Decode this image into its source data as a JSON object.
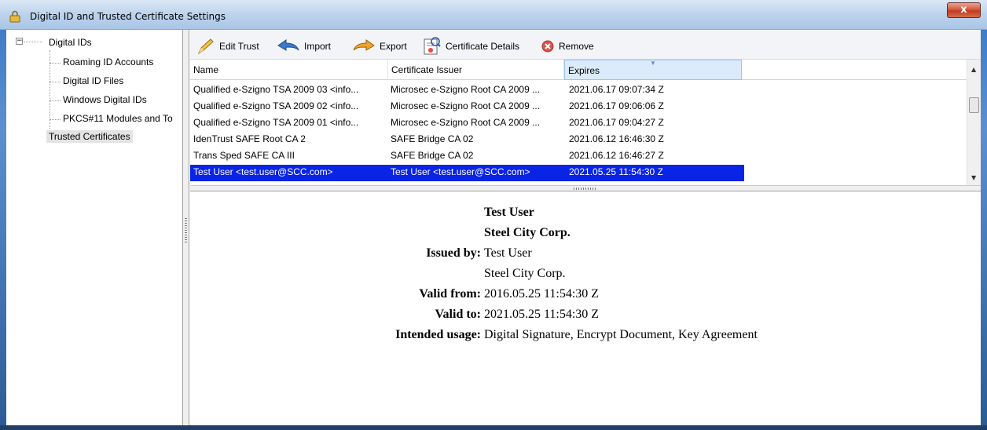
{
  "window": {
    "title": "Digital ID and Trusted Certificate Settings",
    "close_label": "x"
  },
  "tree": {
    "root": "Digital IDs",
    "children": [
      "Roaming ID Accounts",
      "Digital ID Files",
      "Windows Digital IDs",
      "PKCS#11 Modules and To"
    ],
    "trusted": "Trusted Certificates"
  },
  "toolbar": {
    "edit_trust": "Edit Trust",
    "import": "Import",
    "export": "Export",
    "certificate_details": "Certificate Details",
    "remove": "Remove"
  },
  "table": {
    "columns": [
      "Name",
      "Certificate Issuer",
      "Expires"
    ],
    "rows": [
      {
        "name": "Qualified e-Szigno TSA 2009 03 <info...",
        "issuer": "Microsec e-Szigno Root CA 2009 ...",
        "expires": "2021.06.17 09:07:34 Z"
      },
      {
        "name": "Qualified e-Szigno TSA 2009 02 <info...",
        "issuer": "Microsec e-Szigno Root CA 2009 ...",
        "expires": "2021.06.17 09:06:06 Z"
      },
      {
        "name": "Qualified e-Szigno TSA 2009 01 <info...",
        "issuer": "Microsec e-Szigno Root CA 2009 ...",
        "expires": "2021.06.17 09:04:27 Z"
      },
      {
        "name": "IdenTrust SAFE Root CA 2",
        "issuer": "SAFE Bridge CA 02",
        "expires": "2021.06.12 16:46:30 Z"
      },
      {
        "name": "Trans Sped SAFE CA III",
        "issuer": "SAFE Bridge CA 02",
        "expires": "2021.06.12 16:46:27 Z"
      },
      {
        "name": "Test User <test.user@SCC.com>",
        "issuer": "Test User <test.user@SCC.com>",
        "expires": "2021.05.25 11:54:30 Z",
        "selected": true
      }
    ]
  },
  "details": {
    "subject_name": "Test User",
    "subject_org": "Steel City Corp.",
    "issued_by_label": "Issued by:",
    "issued_by_name": "Test User",
    "issued_by_org": "Steel City Corp.",
    "valid_from_label": "Valid from:",
    "valid_from": "2016.05.25 11:54:30 Z",
    "valid_to_label": "Valid to:",
    "valid_to": "2021.05.25 11:54:30 Z",
    "usage_label": "Intended usage:",
    "usage": "Digital Signature, Encrypt Document, Key Agreement"
  },
  "colors": {
    "selection": "#0a24e6",
    "title_gradient": "#bcd3ec",
    "close_button": "#c23b1d"
  }
}
